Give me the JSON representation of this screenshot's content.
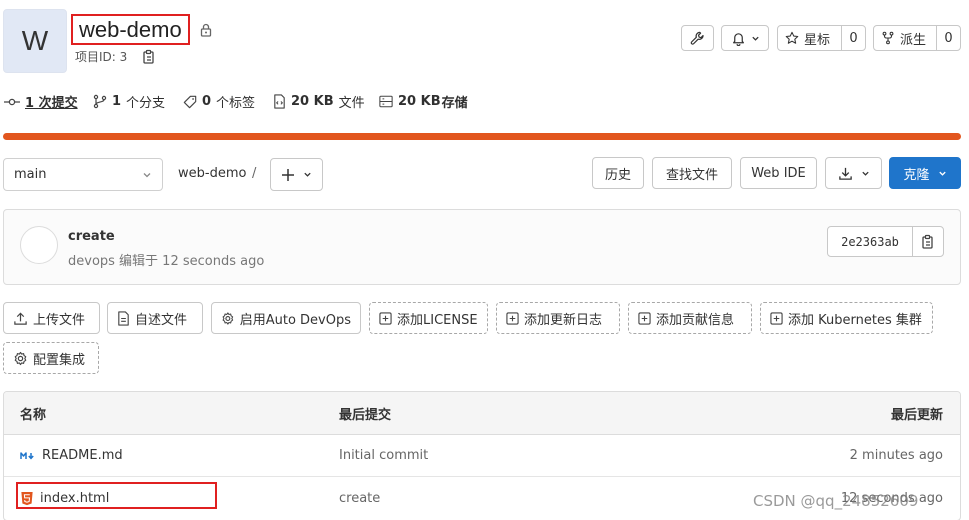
{
  "project": {
    "avatar_letter": "W",
    "title": "web-demo",
    "id_label": "项目ID: 3"
  },
  "header_actions": {
    "star_label": "星标",
    "star_count": "0",
    "fork_label": "派生",
    "fork_count": "0"
  },
  "stats": {
    "commits": "1 次提交",
    "branches_num": "1",
    "branches_label": "个分支",
    "tags_num": "0",
    "tags_label": "个标签",
    "files_size": "20 KB",
    "files_label": "文件",
    "storage_size": "20 KB",
    "storage_label": "存储"
  },
  "language_bar": {
    "color": "#e2561e",
    "percent": 100
  },
  "repo_nav": {
    "branch": "main",
    "breadcrumb": "web-demo",
    "separator": "/",
    "history": "历史",
    "find_file": "查找文件",
    "web_ide": "Web IDE",
    "clone": "克隆"
  },
  "last_commit": {
    "title": "create",
    "meta": "devops 编辑于 12 seconds ago",
    "sha": "2e2363ab"
  },
  "quick_actions": [
    "上传文件",
    "自述文件",
    "启用Auto DevOps",
    "添加LICENSE",
    "添加更新日志",
    "添加贡献信息",
    "添加 Kubernetes 集群",
    "配置集成"
  ],
  "file_table": {
    "headers": {
      "name": "名称",
      "last_commit": "最后提交",
      "last_update": "最后更新"
    },
    "rows": [
      {
        "name": "README.md",
        "commit": "Initial commit",
        "updated": "2 minutes ago",
        "icon": "markdown-icon"
      },
      {
        "name": "index.html",
        "commit": "create",
        "updated": "12 seconds ago",
        "icon": "html5-icon"
      }
    ]
  },
  "watermark": "CSDN @qq_24852609",
  "colors": {
    "primary": "#1f75cb",
    "language": "#e2561e",
    "highlight": "#e02020"
  }
}
